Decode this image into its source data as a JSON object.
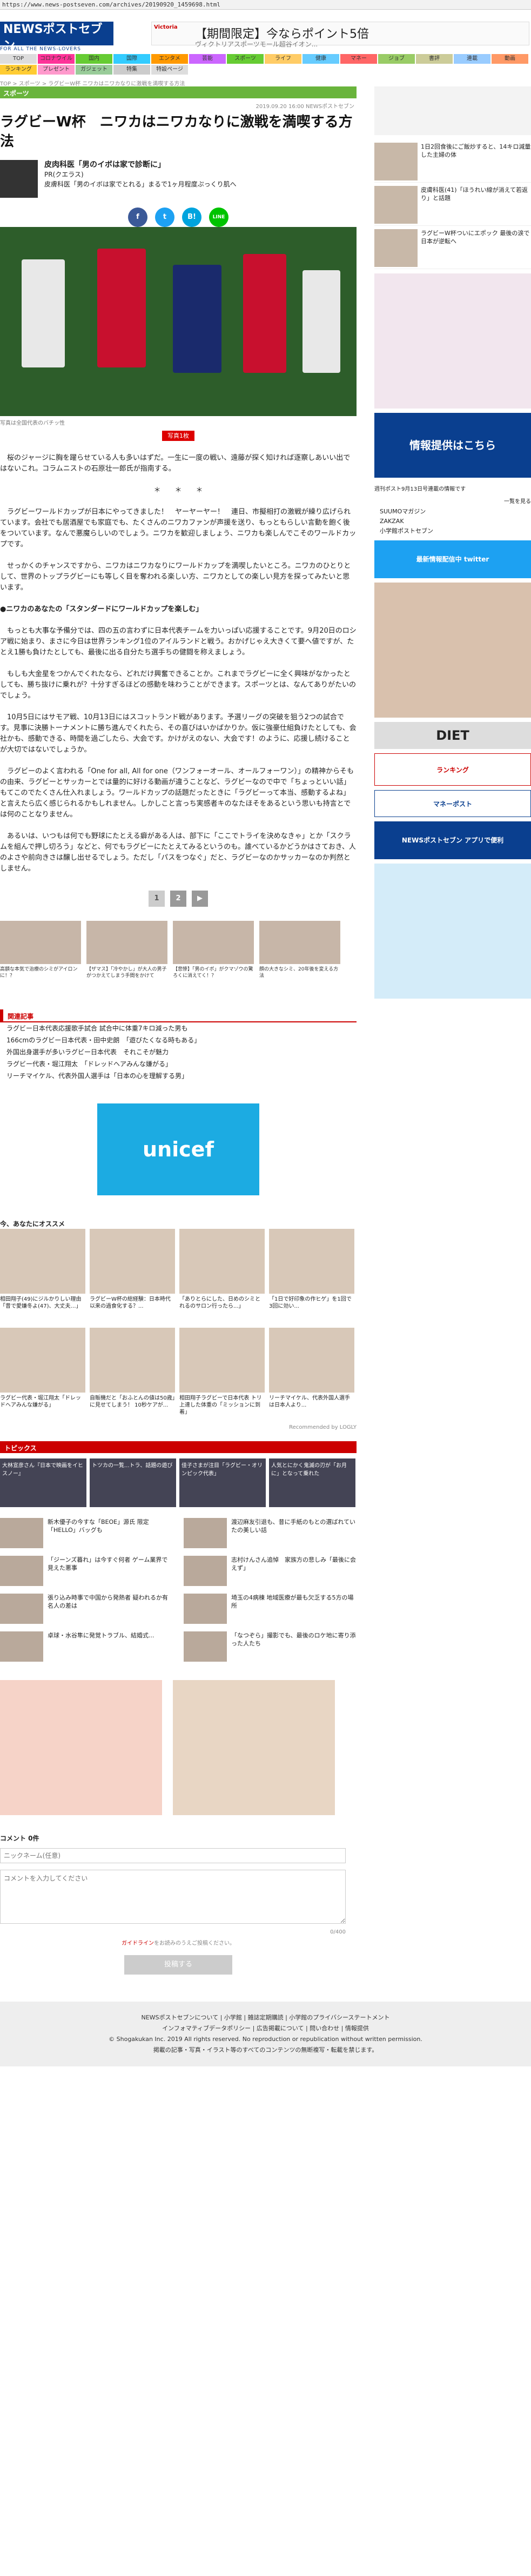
{
  "url": "https://www.news-postseven.com/archives/20190920_1459698.html",
  "site": {
    "logo": "NEWSポストセブン",
    "tagline": "FOR ALL THE NEWS-LOVERS"
  },
  "header_ad": {
    "label": "Victoria",
    "title": "【期間限定】今ならポイント5倍",
    "sub": "ヴィクトリアスポーツモール超谷イオン..."
  },
  "nav": [
    "TOP",
    "コロナウイルス",
    "国内",
    "国際",
    "エンタメ",
    "芸能",
    "スポーツ",
    "ライフ",
    "健康",
    "マネー",
    "ジョブ",
    "書評",
    "連載",
    "動画",
    "ランキング",
    "プレゼント",
    "ガジェット",
    "特集",
    "特設ページ"
  ],
  "breadcrumb": "TOP > スポーツ > ラグビーW杯 ニワカはニワカなりに激戦を満喫する方法",
  "section": "スポーツ",
  "article": {
    "date": "2019.09.20 16:00 NEWSポストセブン",
    "title": "ラグビーW杯　ニワカはニワカなりに激戦を満喫する方法",
    "author_name": "皮肉科医「男のイボは家で診断に」",
    "author_pr": "PR(クエラス)",
    "author_desc": "皮膚科医「男のイボは家でとれる」まるで1ヶ月程度ぷっくり肌へ",
    "share": [
      "f",
      "t",
      "B!",
      "LINE"
    ],
    "caption": "写真は全国代表のバチッ性",
    "photo_count": "写真1枚",
    "paragraphs": [
      "　桜のジャージに胸を躍らせている人も多いはずだ。一生に一度の戦い、遠藤が探く知ければ逐察しあいい出ではないこれ。コラムニストの石原壮一郎氏が指南する。",
      "＊　　＊　　＊",
      "　ラグビーワールドカップが日本にやってきました！　ヤーヤーヤー！　連日、市擬相打の激戦が繰り広げられています。会社でも居酒屋でも家庭でも、たくさんのニワカファンが声援を送り、もっともらしい言動を飽く後をついています。なんで悪魔らしいのでしょう。ニワカを歓迎しましょう、ニワカも楽しんでこそのワールドカップです。",
      "　せっかくのチャンスですから、ニワカはニワカなりにワールドカップを満喫したいところ。ニワカのひとりとして、世界のトップラグビーにも等しく目を奪われる楽しい方、ニワカとしての楽しい見方を探ってみたいと思います。",
      "●ニワカのあなたの「スタンダードにワールドカップを楽しむ」",
      "　もっとも大事な予備分では、四の五の言わずに日本代表チームを力いっぱい応援することです。9月20日のロシア戦に始まり、まさに今日は世界ランキング1位のアイルランドと戦う。おかげじゃえ大きくて要へ値ですが、たとえ1勝も負けたとしても、最後に出る自分たち選手ちの健闘を称えましょう。",
      "　もしも大金星をつかんでくれたなら、どれだけ興奮できることか。これまでラグビーに全く興味がなかったとしても、勝ち抜けに乗れが？十分すぎるほどの感動を味わうことができます。スポーツとは、なんてありがたいのでしょう。",
      "　10月5日にはサモア戦、10月13日にはスコットランド戦があります。予選リーグの突破を狙う2つの試合です。見事に決勝トーナメントに勝ち進んでくれたら、その喜びはいかばかりか。仮に強豪仕組負けたとしても、会社かも、感動できる、時間を過ごしたら、大会です。かけがえのない、大会です！のように、応援し続けることが大切ではないでしょうか。",
      "　ラグビーのよく言われる「One for all, All for one（ワンフォーオール、オールフォーワン）」の精神からそもの由来、ラグビーとサッカーとでは量的に好ける動画が違うことなど、ラグビーなので中で「ちょっといい話」もてこのでたくさん仕入れましょう。ワールドカップの話題だったときに「ラグビーって本当、感動するよね」と言えたら広く感じられるかもしれません。しかしこと言っち実感者キのなたほそをあるという思いも持言とでは何のことなりません。",
      "　あるいは、いつもは何でも野球にたとえる癖がある人は、部下に「ここでトライを決めなきゃ」とか「スクラムを組んで押し切ろう」などと、何でもラグビーにたとえてみるというのも。誰べているかどうかはさておき、人のよさや前向きさは醸し出せるでしょう。ただし「パスをつなぐ」だと、ラグビーなのかサッカーなのか判然としません。"
    ]
  },
  "pager": [
    "1",
    "2",
    "▶"
  ],
  "related": [
    "高額な本気で治療のシミがアイロンに！？",
    "【ザマス】「冷やかし」が大人の男子がつかえてしまう手間をかけて",
    "【悲惨】「男のイボ」がクマゾウの驚ろくに消えてく！？",
    "顔の大きなシミ、20年後を変える方法"
  ],
  "related_section": "関連記事",
  "related_links": [
    "ラグビー日本代表応援歌手試合 試合中に体重7キロ減った男も",
    "166cmのラグビー日本代表・田中史朗　「遊びたくなる時もある」",
    "外国出身選手が多いラグビー日本代表　それこそが魅力",
    "ラグビー代表・堀江翔太　「ドレッドヘアみんな嫌がる」",
    "リーチマイケル、代表外国人選手は「日本の心を理解する男」"
  ],
  "unicef": "unicef",
  "recommend_head": "今、あなたにオススメ",
  "recommend": [
    "相田翔子(49)にジルかりしい理由「昔で愛嫌冬よ(47)、大丈夫…」",
    "ラグビーW杯の総経験：日本時代以来の過食化する？...",
    "「ありとらにした、日めのシミとれるのサロン行ったら...」",
    "「1日で好印象の作ヒゲ」を1回で3回に効い...",
    "ラグビー代表・堀江翔太「ドレッドヘアみんな嫌がる」",
    "自販機だと「おふとんの値は50歳」に見せてしまう！ 10秒ケアが...",
    "相田翔子ラグビーで日本代表 トリ 上達した体重の「ミッションに到着」",
    "リーチマイケル、代表外国人選手は日本人より..."
  ],
  "recommend_footer": "Recommended by LOGLY",
  "topics_head": "トピックス",
  "topic_images": [
    "大林宣彦さん『日本で映画をイヒスノー』",
    "トツカの一覧...トラ、話題の遊び",
    "佳子さまが注目「ラグビー・オリンピック代表」",
    "人気とにかく鬼滅の刃が「お月に」となって乗れた",
    "新型コロナ「なぜ日本人の美しさ」"
  ],
  "topics": [
    "新木優子の今すな「BEOE」源氏 限定「HELLO」バッグも",
    "渡辺麻友引退も、昔に手紙のもとの選ばれていたの美しい話",
    "「ジーンズ暮れ」は今すぐ何者 ゲーム業界で見えた悪事",
    "志村けんさん追悼　家族方の悲しみ「最後に会えず」",
    "張り込み時事で中国から発熱者 疑われるか有名人の差は",
    "埼玉の4病棟 地域医療が最も欠乏する5方の場所",
    "卓球・水谷隼に発覚トラブル、結婚式...",
    "「なつぞら」撮影でも、最後のロケ地に寄り添った人たち"
  ],
  "comment": {
    "heading": "コメント 0件",
    "name_placeholder": "ニックネーム(任意)",
    "text_placeholder": "コメントを入力してください",
    "counter": "0/400",
    "note_link": "ガイドライン",
    "note_rest": "をお読みのうえご投稿ください。",
    "submit": "投稿する"
  },
  "sidebar": {
    "items": [
      "1日2回食後にご飯炒すると、14キロ減量した主婦の体",
      "皮膚科医(41)「ほうれい線が消えて若返り」と話題",
      "ラグビーW杯ついにエポック 最後の涙で日本が逆転へ"
    ],
    "banner1": "情報提供はこちら",
    "banner1_note": "週刊ポスト9月13日号連載の情報です",
    "more_label": "一覧を見る",
    "links": [
      "SUUMOマガジン",
      "ZAKZAK",
      "小学館ポストセブン"
    ],
    "twitter": "最新情報配信中 twitter",
    "diet": "DIET",
    "ranking": "ランキング",
    "mone_post": "マネーポスト",
    "news_app": "NEWSポストセブン アプリで便利"
  },
  "footer": {
    "line1": "NEWSポストセブンについて | 小学館 | 雑誌定期購読 | 小学館のプライバシーステートメント",
    "line2": "インフォマティブデータポリシー | 広告掲載について | 問い合わせ | 情報提供",
    "line3": "© Shogakukan Inc. 2019  All rights reserved. No reproduction or republication without written permission.",
    "line4": "掲載の記事・写真・イラスト等のすべてのコンテンツの無断複写・転載を禁じます。"
  },
  "colors": {
    "brand": "#0a3f8f",
    "green": "#69b43c",
    "red": "#cc0000"
  }
}
